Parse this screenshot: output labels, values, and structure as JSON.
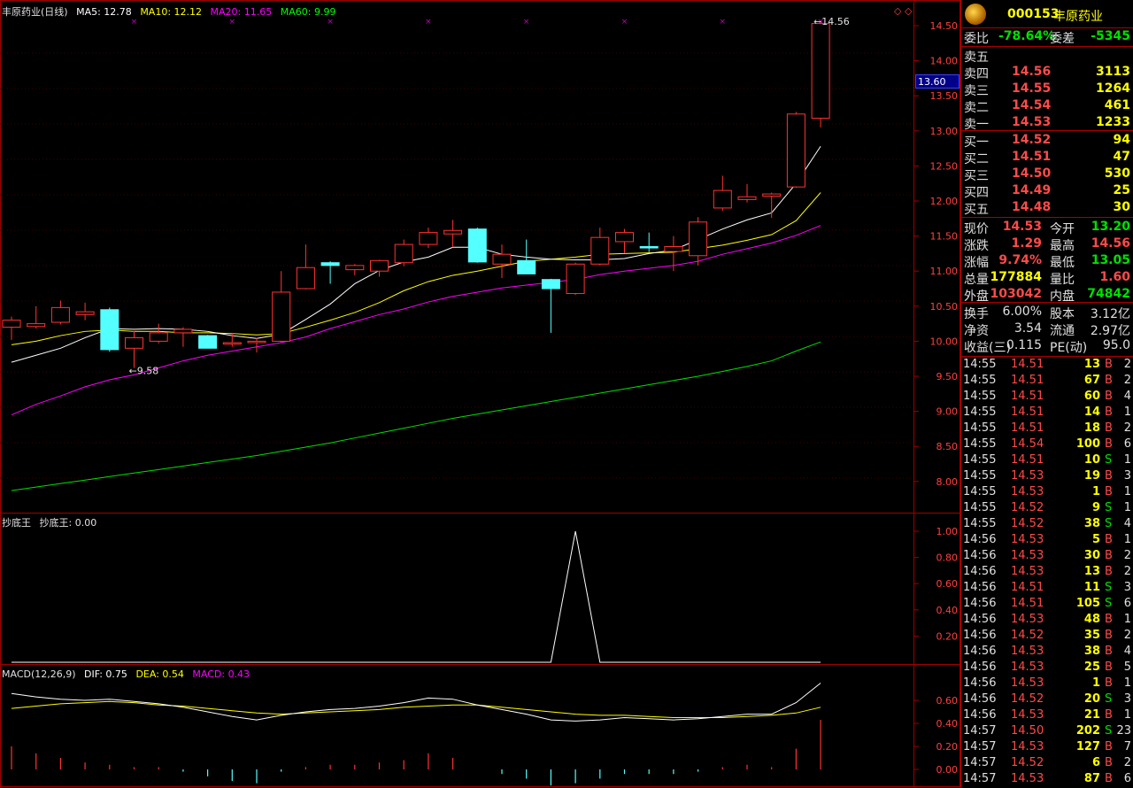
{
  "main_header": {
    "name": "丰原药业(日线)",
    "ma5": "MA5: 12.78",
    "ma10": "MA10: 12.12",
    "ma20": "MA20: 11.65",
    "ma60": "MA60: 9.99",
    "colors": {
      "ma5": "#ffffff",
      "ma10": "#ffff00",
      "ma20": "#ff00ff",
      "ma60": "#00ff00"
    }
  },
  "ind_header": {
    "name": "抄底王",
    "value": "抄底王: 0.00"
  },
  "macd_header": {
    "name": "MACD(12,26,9)",
    "dif": "DIF: 0.75",
    "dea": "DEA: 0.54",
    "macd": "MACD: 0.43"
  },
  "price_label": "13.60",
  "high_label": "14.56",
  "low_label": "9.58",
  "y_axis_main": [
    "14.50",
    "14.00",
    "13.50",
    "13.00",
    "12.50",
    "12.00",
    "11.50",
    "11.00",
    "10.50",
    "10.00",
    "9.50",
    "9.00",
    "8.50",
    "8.00"
  ],
  "y_axis_ind": [
    "1.00",
    "0.80",
    "0.60",
    "0.40",
    "0.20"
  ],
  "y_axis_macd": [
    "0.60",
    "0.40",
    "0.20",
    "0.00"
  ],
  "chart_data": {
    "type": "candlestick",
    "candles": [
      {
        "o": 10.2,
        "h": 10.35,
        "l": 10.02,
        "c": 10.3
      },
      {
        "o": 10.21,
        "h": 10.5,
        "l": 10.18,
        "c": 10.25
      },
      {
        "o": 10.27,
        "h": 10.58,
        "l": 10.24,
        "c": 10.48
      },
      {
        "o": 10.38,
        "h": 10.55,
        "l": 10.3,
        "c": 10.42
      },
      {
        "o": 10.45,
        "h": 10.48,
        "l": 9.85,
        "c": 9.88
      },
      {
        "o": 9.9,
        "h": 10.15,
        "l": 9.62,
        "c": 10.05
      },
      {
        "o": 10.0,
        "h": 10.25,
        "l": 9.97,
        "c": 10.12
      },
      {
        "o": 10.12,
        "h": 10.2,
        "l": 9.92,
        "c": 10.17
      },
      {
        "o": 10.08,
        "h": 10.09,
        "l": 9.9,
        "c": 9.9
      },
      {
        "o": 9.96,
        "h": 10.12,
        "l": 9.92,
        "c": 9.98
      },
      {
        "o": 9.98,
        "h": 10.05,
        "l": 9.84,
        "c": 10.0
      },
      {
        "o": 10.0,
        "h": 11.0,
        "l": 9.98,
        "c": 10.7
      },
      {
        "o": 10.75,
        "h": 11.38,
        "l": 10.74,
        "c": 11.05
      },
      {
        "o": 11.12,
        "h": 11.14,
        "l": 10.82,
        "c": 11.08
      },
      {
        "o": 11.02,
        "h": 11.1,
        "l": 10.94,
        "c": 11.08
      },
      {
        "o": 11.0,
        "h": 11.16,
        "l": 10.92,
        "c": 11.15
      },
      {
        "o": 11.12,
        "h": 11.45,
        "l": 11.07,
        "c": 11.38
      },
      {
        "o": 11.38,
        "h": 11.62,
        "l": 11.33,
        "c": 11.55
      },
      {
        "o": 11.53,
        "h": 11.73,
        "l": 11.34,
        "c": 11.58
      },
      {
        "o": 11.6,
        "h": 11.62,
        "l": 11.12,
        "c": 11.13
      },
      {
        "o": 11.1,
        "h": 11.38,
        "l": 10.9,
        "c": 11.24
      },
      {
        "o": 11.15,
        "h": 11.45,
        "l": 10.98,
        "c": 10.96
      },
      {
        "o": 10.88,
        "h": 10.89,
        "l": 10.12,
        "c": 10.75
      },
      {
        "o": 10.68,
        "h": 11.12,
        "l": 10.66,
        "c": 11.1
      },
      {
        "o": 11.1,
        "h": 11.62,
        "l": 11.08,
        "c": 11.48
      },
      {
        "o": 11.42,
        "h": 11.6,
        "l": 11.26,
        "c": 11.55
      },
      {
        "o": 11.35,
        "h": 11.55,
        "l": 11.27,
        "c": 11.33
      },
      {
        "o": 11.28,
        "h": 11.5,
        "l": 11.0,
        "c": 11.35
      },
      {
        "o": 11.22,
        "h": 11.77,
        "l": 11.08,
        "c": 11.7
      },
      {
        "o": 11.9,
        "h": 12.36,
        "l": 11.86,
        "c": 12.15
      },
      {
        "o": 12.02,
        "h": 12.24,
        "l": 11.98,
        "c": 12.06
      },
      {
        "o": 12.07,
        "h": 12.12,
        "l": 11.76,
        "c": 12.1
      },
      {
        "o": 12.2,
        "h": 13.27,
        "l": 12.19,
        "c": 13.24
      },
      {
        "o": 13.18,
        "h": 14.56,
        "l": 13.05,
        "c": 14.53
      }
    ],
    "ma5": [
      9.7,
      9.8,
      9.9,
      10.05,
      10.18,
      10.17,
      10.18,
      10.17,
      10.14,
      10.08,
      10.04,
      10.1,
      10.31,
      10.53,
      10.82,
      11.01,
      11.13,
      11.2,
      11.34,
      11.34,
      11.24,
      11.2,
      11.17,
      11.16,
      11.16,
      11.18,
      11.25,
      11.3,
      11.45,
      11.6,
      11.73,
      11.83,
      12.25,
      12.78
    ],
    "ma10": [
      9.95,
      10.0,
      10.08,
      10.14,
      10.16,
      10.14,
      10.14,
      10.12,
      10.12,
      10.11,
      10.09,
      10.11,
      10.2,
      10.3,
      10.41,
      10.55,
      10.72,
      10.85,
      10.94,
      11.0,
      11.07,
      11.14,
      11.17,
      11.2,
      11.24,
      11.25,
      11.26,
      11.27,
      11.32,
      11.37,
      11.44,
      11.52,
      11.72,
      12.12
    ],
    "ma20": [
      8.95,
      9.1,
      9.22,
      9.35,
      9.45,
      9.52,
      9.62,
      9.72,
      9.8,
      9.86,
      9.92,
      9.98,
      10.06,
      10.18,
      10.28,
      10.38,
      10.46,
      10.56,
      10.64,
      10.7,
      10.76,
      10.8,
      10.84,
      10.88,
      10.95,
      11.0,
      11.04,
      11.08,
      11.14,
      11.24,
      11.32,
      11.4,
      11.51,
      11.65
    ],
    "ma60": [
      7.87,
      7.92,
      7.97,
      8.02,
      8.07,
      8.12,
      8.17,
      8.22,
      8.27,
      8.32,
      8.37,
      8.43,
      8.49,
      8.55,
      8.62,
      8.69,
      8.76,
      8.83,
      8.9,
      8.96,
      9.02,
      9.08,
      9.14,
      9.2,
      9.26,
      9.32,
      9.38,
      9.44,
      9.5,
      9.57,
      9.64,
      9.72,
      9.86,
      9.99
    ],
    "indicator": [
      0,
      0,
      0,
      0,
      0,
      0,
      0,
      0,
      0,
      0,
      0,
      0,
      0,
      0,
      0,
      0,
      0,
      0,
      0,
      0,
      0,
      0,
      0,
      1,
      0,
      0,
      0,
      0,
      0,
      0,
      0,
      0,
      0,
      0
    ],
    "dif": [
      0.66,
      0.63,
      0.61,
      0.6,
      0.61,
      0.59,
      0.57,
      0.54,
      0.5,
      0.46,
      0.43,
      0.47,
      0.5,
      0.52,
      0.53,
      0.55,
      0.58,
      0.62,
      0.61,
      0.56,
      0.52,
      0.48,
      0.43,
      0.42,
      0.43,
      0.45,
      0.44,
      0.43,
      0.44,
      0.46,
      0.48,
      0.48,
      0.58,
      0.75
    ],
    "dea": [
      0.53,
      0.55,
      0.57,
      0.58,
      0.59,
      0.58,
      0.56,
      0.55,
      0.53,
      0.51,
      0.49,
      0.48,
      0.49,
      0.5,
      0.51,
      0.52,
      0.54,
      0.55,
      0.56,
      0.56,
      0.54,
      0.52,
      0.5,
      0.48,
      0.47,
      0.47,
      0.46,
      0.45,
      0.45,
      0.45,
      0.46,
      0.47,
      0.49,
      0.54
    ],
    "macd_hist": [
      0.2,
      0.14,
      0.1,
      0.06,
      0.04,
      0.02,
      0.02,
      -0.02,
      -0.06,
      -0.1,
      -0.12,
      -0.02,
      0.02,
      0.04,
      0.04,
      0.06,
      0.08,
      0.14,
      0.1,
      0.0,
      -0.04,
      -0.08,
      -0.14,
      -0.12,
      -0.08,
      -0.04,
      -0.04,
      -0.04,
      -0.02,
      0.02,
      0.04,
      0.02,
      0.18,
      0.43
    ]
  },
  "sidebar": {
    "code": "000153",
    "name": "丰原药业",
    "weibi_label": "委比",
    "weibi": "-78.64%",
    "weicha_label": "委差",
    "weicha": "-5345",
    "asks": [
      {
        "label": "卖五",
        "price": "",
        "vol": ""
      },
      {
        "label": "卖四",
        "price": "14.56",
        "vol": "3113"
      },
      {
        "label": "卖三",
        "price": "14.55",
        "vol": "1264"
      },
      {
        "label": "卖二",
        "price": "14.54",
        "vol": "461"
      },
      {
        "label": "卖一",
        "price": "14.53",
        "vol": "1233"
      }
    ],
    "bids": [
      {
        "label": "买一",
        "price": "14.52",
        "vol": "94"
      },
      {
        "label": "买二",
        "price": "14.51",
        "vol": "47"
      },
      {
        "label": "买三",
        "price": "14.50",
        "vol": "530"
      },
      {
        "label": "买四",
        "price": "14.49",
        "vol": "25"
      },
      {
        "label": "买五",
        "price": "14.48",
        "vol": "30"
      }
    ],
    "quote": [
      {
        "l1": "现价",
        "v1": "14.53",
        "c1": "red",
        "l2": "今开",
        "v2": "13.20",
        "c2": "green"
      },
      {
        "l1": "涨跌",
        "v1": "1.29",
        "c1": "red",
        "l2": "最高",
        "v2": "14.56",
        "c2": "red"
      },
      {
        "l1": "涨幅",
        "v1": "9.74%",
        "c1": "red",
        "l2": "最低",
        "v2": "13.05",
        "c2": "green"
      },
      {
        "l1": "总量",
        "v1": "177884",
        "c1": "yellow",
        "l2": "量比",
        "v2": "1.60",
        "c2": "red"
      },
      {
        "l1": "外盘",
        "v1": "103042",
        "c1": "red",
        "l2": "内盘",
        "v2": "74842",
        "c2": "green"
      }
    ],
    "stats": [
      {
        "l1": "换手",
        "v1": "6.00%",
        "l2": "股本",
        "v2": "3.12亿"
      },
      {
        "l1": "净资",
        "v1": "3.54",
        "l2": "流通",
        "v2": "2.97亿"
      },
      {
        "l1": "收益(三)",
        "v1": "0.115",
        "l2": "PE(动)",
        "v2": "95.0"
      }
    ],
    "ticks": [
      {
        "time": "14:55",
        "price": "14.51",
        "vol": "13",
        "bs": "B",
        "n": "2"
      },
      {
        "time": "14:55",
        "price": "14.51",
        "vol": "67",
        "bs": "B",
        "n": "2"
      },
      {
        "time": "14:55",
        "price": "14.51",
        "vol": "60",
        "bs": "B",
        "n": "4"
      },
      {
        "time": "14:55",
        "price": "14.51",
        "vol": "14",
        "bs": "B",
        "n": "1"
      },
      {
        "time": "14:55",
        "price": "14.51",
        "vol": "18",
        "bs": "B",
        "n": "2"
      },
      {
        "time": "14:55",
        "price": "14.54",
        "vol": "100",
        "bs": "B",
        "n": "6"
      },
      {
        "time": "14:55",
        "price": "14.51",
        "vol": "10",
        "bs": "S",
        "n": "1"
      },
      {
        "time": "14:55",
        "price": "14.53",
        "vol": "19",
        "bs": "B",
        "n": "3"
      },
      {
        "time": "14:55",
        "price": "14.53",
        "vol": "1",
        "bs": "B",
        "n": "1"
      },
      {
        "time": "14:55",
        "price": "14.52",
        "vol": "9",
        "bs": "S",
        "n": "1"
      },
      {
        "time": "14:55",
        "price": "14.52",
        "vol": "38",
        "bs": "S",
        "n": "4"
      },
      {
        "time": "14:56",
        "price": "14.53",
        "vol": "5",
        "bs": "B",
        "n": "1"
      },
      {
        "time": "14:56",
        "price": "14.53",
        "vol": "30",
        "bs": "B",
        "n": "2"
      },
      {
        "time": "14:56",
        "price": "14.53",
        "vol": "13",
        "bs": "B",
        "n": "2"
      },
      {
        "time": "14:56",
        "price": "14.51",
        "vol": "11",
        "bs": "S",
        "n": "3"
      },
      {
        "time": "14:56",
        "price": "14.51",
        "vol": "105",
        "bs": "S",
        "n": "6"
      },
      {
        "time": "14:56",
        "price": "14.53",
        "vol": "48",
        "bs": "B",
        "n": "1"
      },
      {
        "time": "14:56",
        "price": "14.52",
        "vol": "35",
        "bs": "B",
        "n": "2"
      },
      {
        "time": "14:56",
        "price": "14.53",
        "vol": "38",
        "bs": "B",
        "n": "4"
      },
      {
        "time": "14:56",
        "price": "14.53",
        "vol": "25",
        "bs": "B",
        "n": "5"
      },
      {
        "time": "14:56",
        "price": "14.53",
        "vol": "1",
        "bs": "B",
        "n": "1"
      },
      {
        "time": "14:56",
        "price": "14.52",
        "vol": "20",
        "bs": "S",
        "n": "3"
      },
      {
        "time": "14:56",
        "price": "14.53",
        "vol": "21",
        "bs": "B",
        "n": "1"
      },
      {
        "time": "14:57",
        "price": "14.50",
        "vol": "202",
        "bs": "S",
        "n": "23"
      },
      {
        "time": "14:57",
        "price": "14.53",
        "vol": "127",
        "bs": "B",
        "n": "7"
      },
      {
        "time": "14:57",
        "price": "14.52",
        "vol": "6",
        "bs": "B",
        "n": "2"
      },
      {
        "time": "14:57",
        "price": "14.53",
        "vol": "87",
        "bs": "B",
        "n": "6"
      }
    ]
  }
}
